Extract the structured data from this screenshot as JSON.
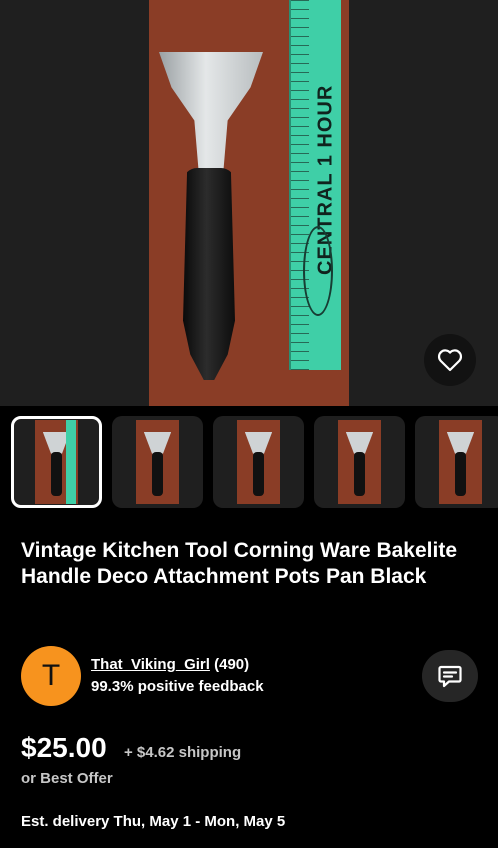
{
  "hero": {
    "ruler_text": "CENTRAL 1 HOUR",
    "favorite_icon": "heart-outline-icon"
  },
  "thumbnails": [
    {
      "label": "photo 1",
      "selected": true
    },
    {
      "label": "photo 2",
      "selected": false
    },
    {
      "label": "photo 3",
      "selected": false
    },
    {
      "label": "photo 4",
      "selected": false
    },
    {
      "label": "photo 5",
      "selected": false
    }
  ],
  "listing": {
    "title": "Vintage Kitchen Tool Corning Ware Bakelite Handle Deco Attachment Pots Pan Black"
  },
  "seller": {
    "avatar_letter": "T",
    "name": "That_Viking_Girl",
    "rating_count": "(490)",
    "feedback": "99.3% positive feedback",
    "message_icon": "message-icon"
  },
  "pricing": {
    "price": "$25.00",
    "shipping": "+ $4.62 shipping",
    "offer": "or Best Offer",
    "delivery": "Est. delivery Thu, May 1 - Mon, May 5"
  },
  "colors": {
    "background": "#000000",
    "avatar": "#f7931e",
    "button_bg": "#262626",
    "secondary_text": "#c7c7c7"
  }
}
